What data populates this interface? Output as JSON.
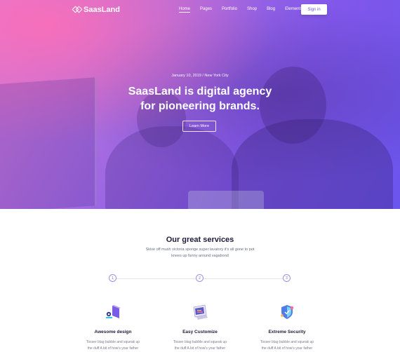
{
  "nav": {
    "logo_text": "SaasLand",
    "items": [
      {
        "label": "Home",
        "active": true
      },
      {
        "label": "Pages",
        "active": false
      },
      {
        "label": "Portfolio",
        "active": false
      },
      {
        "label": "Shop",
        "active": false
      },
      {
        "label": "Blog",
        "active": false
      },
      {
        "label": "Elements",
        "active": false
      }
    ],
    "signin_label": "Sign in"
  },
  "hero": {
    "date_location": "January 10, 2019 / New York City",
    "headline_line1": "SaasLand is digital agency",
    "headline_line2": "for pioneering brands.",
    "cta_label": "Learn More"
  },
  "services": {
    "title": "Our great services",
    "subtitle_line1": "Skive off mush victoria sponge super lavatory it's all gone to pot",
    "subtitle_line2": "knees up fanny around vagabond",
    "steps": [
      "1",
      "2",
      "3"
    ],
    "items": [
      {
        "name": "Awesome design",
        "desc_line1": "Tosser blag bubble and squeak up",
        "desc_line2": "the duff A bit of how's your father",
        "icon": "design-icon"
      },
      {
        "name": "Easy Customize",
        "desc_line1": "Tosser blag bubble and squeak up",
        "desc_line2": "the duff A bit of how's your father",
        "icon": "customize-icon"
      },
      {
        "name": "Extreme Security",
        "desc_line1": "Tosser blag bubble and squeak up",
        "desc_line2": "the duff A bit of how's your father",
        "icon": "security-icon"
      }
    ]
  },
  "colors": {
    "accent": "#6f55e8",
    "heading": "#1e1b3a",
    "body_text": "#6b6e85"
  }
}
